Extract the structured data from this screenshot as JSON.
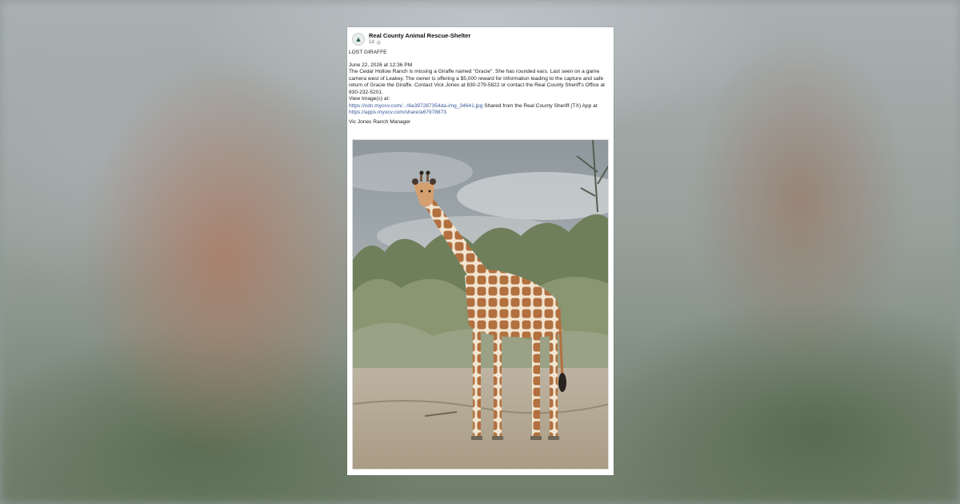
{
  "post": {
    "page_name": "Real County Animal Rescue-Shelter",
    "time": "1d",
    "visibility_icon": "globe-icon",
    "title": "LOST GIRAFFE",
    "date": "June 22, 2026 at 12:36 PM",
    "body": "The Cedar Hollow Ranch is missing a Giraffe named \"Gracie\". She has rounded ears. Last seen on a game camera west of Leakey. The owner is offering a $5,000 reward for information leading to the capture and safe return of Gracie the Giraffe. Contact Vick Jones at 830-279-5822 or contact the Real County Sheriff's Office at 830-232-5201.",
    "view_images_label": "View Image(s) at:",
    "image_link": "https://cdn.myocv.com/.../6a397287354da-img_34641.jpg",
    "shared_from": "Shared from the Real County Sheriff (TX) App at",
    "app_link": "https://apps.myocv.com/share/a67978873",
    "signature": "Vic Jones Ranch Manager"
  },
  "photo": {
    "subject": "giraffe-photo"
  }
}
